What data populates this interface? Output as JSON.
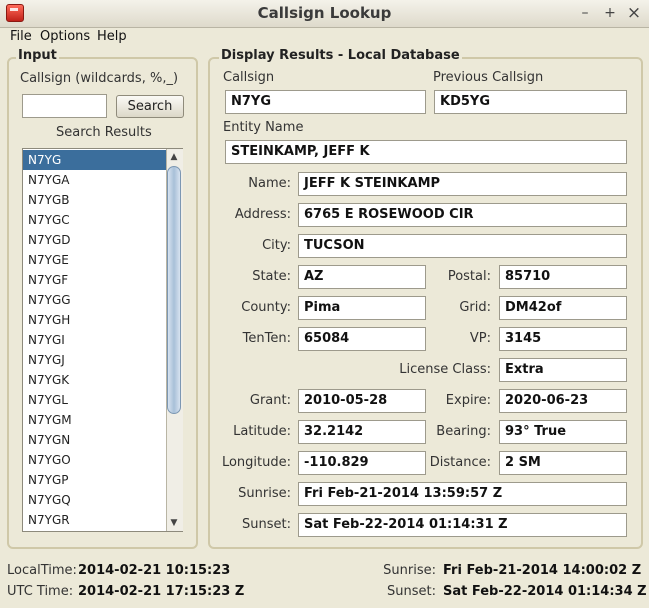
{
  "window": {
    "title": "Callsign Lookup",
    "minimize": "–",
    "maximize": "+",
    "close": "×"
  },
  "menu": [
    "File",
    "Options",
    "Help"
  ],
  "input": {
    "legend": "Input",
    "callsign_label": "Callsign (wildcards, %,_)",
    "search_value": "",
    "search_button": "Search",
    "results_label": "Search Results",
    "results": [
      "N7YG",
      "N7YGA",
      "N7YGB",
      "N7YGC",
      "N7YGD",
      "N7YGE",
      "N7YGF",
      "N7YGG",
      "N7YGH",
      "N7YGI",
      "N7YGJ",
      "N7YGK",
      "N7YGL",
      "N7YGM",
      "N7YGN",
      "N7YGO",
      "N7YGP",
      "N7YGQ",
      "N7YGR"
    ],
    "selected": "N7YG",
    "scroll_up": "▲",
    "scroll_down": "▼"
  },
  "display": {
    "legend": "Display Results - Local Database",
    "callsign_label": "Callsign",
    "callsign": "N7YG",
    "prev_callsign_label": "Previous Callsign",
    "prev_callsign": "KD5YG",
    "entity_label": "Entity Name",
    "entity": "STEINKAMP, JEFF K",
    "name_label": "Name:",
    "name": "JEFF K STEINKAMP",
    "address_label": "Address:",
    "address": "6765 E ROSEWOOD CIR",
    "city_label": "City:",
    "city": "TUCSON",
    "state_label": "State:",
    "state": "AZ",
    "postal_label": "Postal:",
    "postal": "85710",
    "county_label": "County:",
    "county": "Pima",
    "grid_label": "Grid:",
    "grid": "DM42of",
    "tenten_label": "TenTen:",
    "tenten": "65084",
    "vp_label": "VP:",
    "vp": "3145",
    "license_label": "License Class:",
    "license": "Extra",
    "grant_label": "Grant:",
    "grant": "2010-05-28",
    "expire_label": "Expire:",
    "expire": "2020-06-23",
    "latitude_label": "Latitude:",
    "latitude": "32.2142",
    "bearing_label": "Bearing:",
    "bearing": "93° True",
    "longitude_label": "Longitude:",
    "longitude": "-110.829",
    "distance_label": "Distance:",
    "distance": "2 SM",
    "sunrise_label": "Sunrise:",
    "sunrise": "Fri Feb-21-2014  13:59:57 Z",
    "sunset_label": "Sunset:",
    "sunset": "Sat Feb-22-2014  01:14:31 Z"
  },
  "status": {
    "local_label": "LocalTime:",
    "local": "2014-02-21 10:15:23",
    "utc_label": "UTC Time:",
    "utc": "2014-02-21 17:15:23 Z",
    "sunrise_label": "Sunrise:",
    "sunrise": "Fri Feb-21-2014  14:00:02 Z",
    "sunset_label": "Sunset:",
    "sunset": "Sat Feb-22-2014  01:14:34 Z"
  }
}
